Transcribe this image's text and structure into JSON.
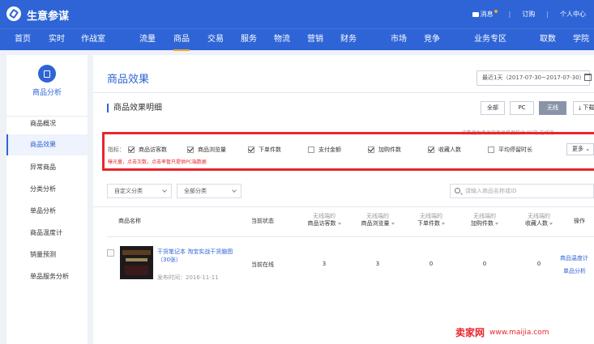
{
  "header": {
    "brand": "生意参谋",
    "messages": "消息",
    "subscribe": "订购",
    "user_center": "个人中心"
  },
  "nav": [
    "首页",
    "实时",
    "作战室",
    "流量",
    "商品",
    "交易",
    "服务",
    "物流",
    "营销",
    "财务",
    "市场",
    "竞争",
    "业务专区",
    "取数",
    "学院"
  ],
  "nav_active": "商品",
  "sidebar": {
    "title": "商品分析",
    "items": [
      "商品概况",
      "商品效果",
      "异常商品",
      "分类分析",
      "单品分析",
      "商品温度计",
      "销量预测",
      "单品服务分析"
    ],
    "active": "商品效果"
  },
  "main": {
    "title": "商品效果",
    "date_range": "最近1天（2017-07-30~2017-07-30）",
    "section_title": "商品效果明细",
    "terminals": [
      "全部",
      "PC",
      "无线"
    ],
    "terminal_active": "无线",
    "download": "下载",
    "note_top": "该数据为商品的商品维度统计 PC端 无线端",
    "indicator_label": "指标：",
    "metrics": [
      {
        "label": "商品访客数",
        "checked": true
      },
      {
        "label": "商品浏览量",
        "checked": true
      },
      {
        "label": "下单件数",
        "checked": true
      },
      {
        "label": "支付金额",
        "checked": false
      },
      {
        "label": "加购件数",
        "checked": true
      },
      {
        "label": "收藏人数",
        "checked": true
      },
      {
        "label": "平均停留时长",
        "checked": false
      }
    ],
    "more": "更多",
    "warning": "曝光量，点击次数，点击率暂只提供PC端数据",
    "filter_custom": "自定义分类",
    "filter_all": "全部分类",
    "search_placeholder": "请输入商品名称或ID",
    "columns": {
      "name": "商品名称",
      "status": "当前状态",
      "metric_prefix": "无线端的",
      "visitors": "商品访客数",
      "views": "商品浏览量",
      "orders": "下单件数",
      "carts": "加购件数",
      "favorites": "收藏人数",
      "ops": "操作"
    },
    "rows": [
      {
        "name": "干货笔记本 淘宝实战干货脑图（30张）",
        "publish": "发布时间：2016-11-11",
        "status": "当前在线",
        "visitors": "3",
        "views": "3",
        "orders": "0",
        "carts": "0",
        "favorites": "0",
        "op1": "商品温度计",
        "op2": "单品分析"
      }
    ]
  },
  "watermark": {
    "brand": "卖家网",
    "url": "www.maijia.com"
  },
  "colors": {
    "primary": "#2e64d6",
    "accent": "#f5a623",
    "highlight_box": "#e8262d"
  }
}
